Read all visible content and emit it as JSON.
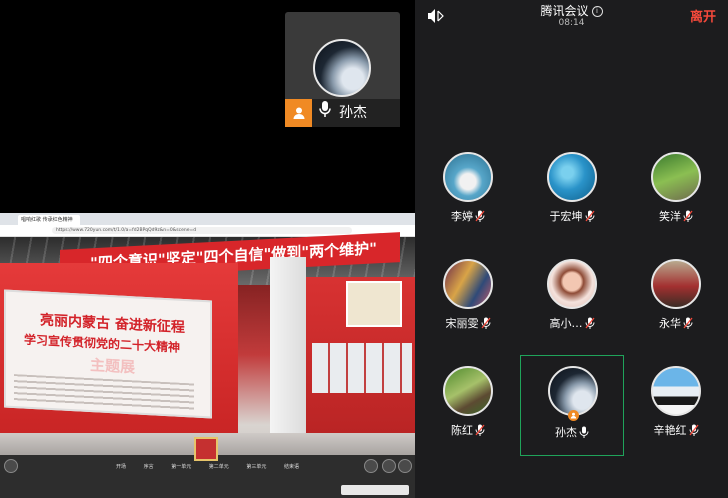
{
  "shared_screen": {
    "browser_tab": "唱响红歌 传承红色精神",
    "url": "https://www.720yun.com/t/1.0/a=fd2BPqQd9z&n=0&scene=d",
    "panorama_banner": "\"四个意识\"坚定\"四个自信\"做到\"两个维护\"",
    "board_title_1": "亮丽内蒙古 奋进新征程",
    "board_title_2": "学习宣传贯彻党的二十大精神",
    "board_title_3": "主题展",
    "bottom_menu": [
      "开场",
      "序言",
      "第一单元",
      "第二单元",
      "第三单元",
      "结束语"
    ]
  },
  "speaker_tile": {
    "name": "孙杰",
    "avatar_icon": "moon-avatar",
    "host_icon": "host-icon",
    "mic_icon": "mic-icon"
  },
  "meeting": {
    "title": "腾讯会议",
    "time": "08:14",
    "leave_label": "离开",
    "leave_color": "#f5493b",
    "active_border_color": "#1fa35a",
    "participants": [
      {
        "name": "李婷",
        "mic": "muted"
      },
      {
        "name": "于宏坤",
        "mic": "muted"
      },
      {
        "name": "笑洋",
        "mic": "muted"
      },
      {
        "name": "宋丽雯",
        "mic": "muted"
      },
      {
        "name": "高小…",
        "mic": "muted"
      },
      {
        "name": "永华",
        "mic": "muted"
      },
      {
        "name": "陈红",
        "mic": "muted"
      },
      {
        "name": "孙杰",
        "mic": "on",
        "host": true
      },
      {
        "name": "辛艳红",
        "mic": "muted"
      }
    ]
  }
}
